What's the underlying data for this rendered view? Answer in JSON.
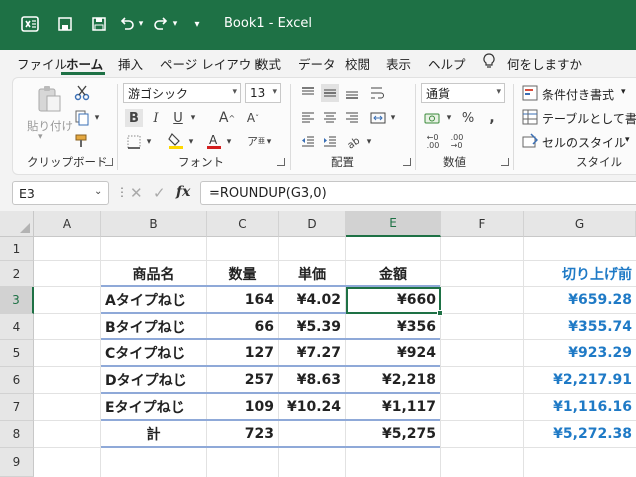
{
  "window": {
    "title": "Book1  -  Excel"
  },
  "menu": {
    "tabs": [
      "ファイル",
      "ホーム",
      "挿入",
      "ページ レイアウト",
      "数式",
      "データ",
      "校閲",
      "表示",
      "ヘルプ"
    ],
    "tell_me": "何をしますか"
  },
  "ribbon": {
    "clipboard": {
      "paste_label": "貼り付け",
      "group_label": "クリップボード"
    },
    "font": {
      "name": "游ゴシック",
      "size": "13",
      "group_label": "フォント"
    },
    "alignment": {
      "group_label": "配置"
    },
    "number": {
      "format": "通貨",
      "group_label": "数値"
    },
    "styles": {
      "conditional": "条件付き書式",
      "table": "テーブルとして書式設",
      "cell_styles": "セルのスタイル",
      "group_label": "スタイル"
    },
    "colors": {
      "fill": "#ffd800",
      "font": "#d41f1f"
    }
  },
  "formula_bar": {
    "name_box": "E3",
    "formula": "=ROUNDUP(G3,0)"
  },
  "sheet": {
    "columns": [
      "A",
      "B",
      "C",
      "D",
      "E",
      "F",
      "G"
    ],
    "rows": [
      "1",
      "2",
      "3",
      "4",
      "5",
      "6",
      "7",
      "8",
      "9"
    ],
    "selected_cell": "E3",
    "headers": {
      "product": "商品名",
      "qty": "数量",
      "price": "単価",
      "amount": "金額",
      "before": "切り上げ前"
    },
    "data_rows": [
      {
        "product": "Aタイプねじ",
        "qty": "164",
        "price": "¥4.02",
        "amount": "¥660",
        "before": "¥659.28"
      },
      {
        "product": "Bタイプねじ",
        "qty": "66",
        "price": "¥5.39",
        "amount": "¥356",
        "before": "¥355.74"
      },
      {
        "product": "Cタイプねじ",
        "qty": "127",
        "price": "¥7.27",
        "amount": "¥924",
        "before": "¥923.29"
      },
      {
        "product": "Dタイプねじ",
        "qty": "257",
        "price": "¥8.63",
        "amount": "¥2,218",
        "before": "¥2,217.91"
      },
      {
        "product": "Eタイプねじ",
        "qty": "109",
        "price": "¥10.24",
        "amount": "¥1,117",
        "before": "¥1,116.16"
      }
    ],
    "total": {
      "label": "計",
      "qty": "723",
      "amount": "¥5,275",
      "before": "¥5,272.38"
    },
    "colors": {
      "accent": "#1e7145",
      "blue_text": "#1f7ac6",
      "table_lines": "#8fa9d8"
    }
  }
}
